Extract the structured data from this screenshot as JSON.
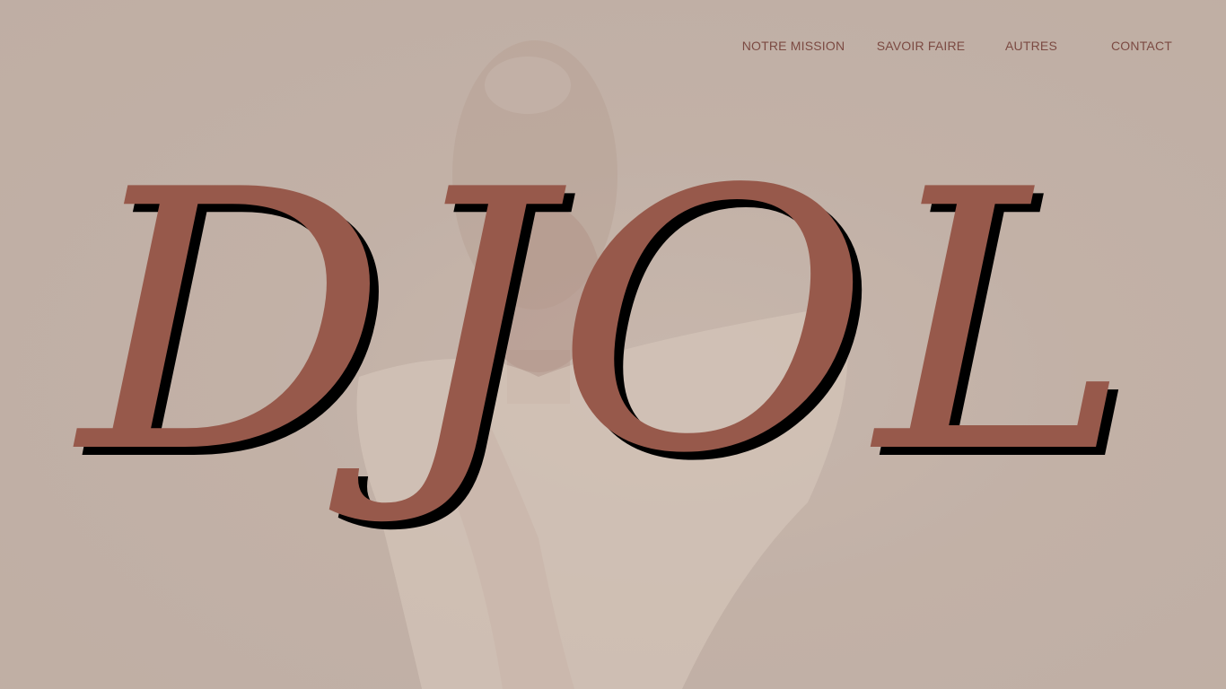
{
  "nav": {
    "items": [
      {
        "label": "NOTRE MISSION"
      },
      {
        "label": "SAVOIR FAIRE"
      },
      {
        "label": "AUTRES"
      },
      {
        "label": "CONTACT"
      }
    ]
  },
  "hero": {
    "brand": "DJOL",
    "background_image": "faded portrait of a woman with braided hair in a light blouse"
  },
  "colors": {
    "background": "#c2b1a6",
    "brand_fill": "#97594b",
    "brand_shadow": "#000000",
    "nav_text": "#7b4a42"
  }
}
